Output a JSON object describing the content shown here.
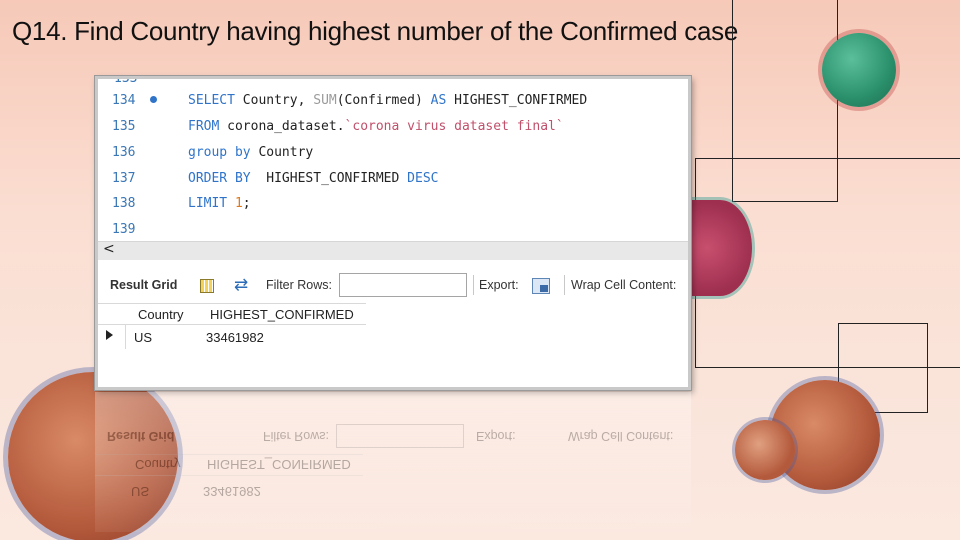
{
  "slide": {
    "title": "Q14. Find Country having highest number of the Confirmed case"
  },
  "editor": {
    "lines": [
      {
        "no": "134",
        "has_marker": true,
        "text": "SELECT Country, SUM(Confirmed) AS HIGHEST_CONFIRMED"
      },
      {
        "no": "135",
        "has_marker": false,
        "text": "FROM corona_dataset.`corona virus dataset final`"
      },
      {
        "no": "136",
        "has_marker": false,
        "text": "group by Country"
      },
      {
        "no": "137",
        "has_marker": false,
        "text": "ORDER BY  HIGHEST_CONFIRMED DESC"
      },
      {
        "no": "138",
        "has_marker": false,
        "text": "LIMIT 1;"
      },
      {
        "no": "139",
        "has_marker": false,
        "text": ""
      }
    ],
    "parts": {
      "l134": {
        "select": "SELECT",
        "a": " Country, ",
        "sum": "SUM",
        "b": "(Confirmed) ",
        "as": "AS",
        "c": " HIGHEST_CONFIRMED"
      },
      "l135": {
        "from": "FROM",
        "a": " corona_dataset.",
        "str": "`corona virus dataset final`"
      },
      "l136": {
        "group": "group by",
        "a": " Country"
      },
      "l137": {
        "order": "ORDER BY",
        "a": "  HIGHEST_CONFIRMED ",
        "desc": "DESC"
      },
      "l138": {
        "limit": "LIMIT",
        "a": " ",
        "num": "1",
        "b": ";"
      }
    },
    "scroll_left_glyph": "<"
  },
  "toolbar": {
    "result_grid_label": "Result Grid",
    "filter_rows_label": "Filter Rows:",
    "filter_rows_value": "",
    "export_label": "Export:",
    "wrap_cell_label": "Wrap Cell Content:"
  },
  "result": {
    "columns": [
      "Country",
      "HIGHEST_CONFIRMED"
    ],
    "rows": [
      [
        "US",
        "33461982"
      ]
    ]
  },
  "colors": {
    "keyword": "#2f74c9",
    "function": "#9b9b9b",
    "string": "#c0506b",
    "number": "#e07a1a",
    "line_number": "#3a77b6"
  },
  "icons": [
    "bullet-dot-icon",
    "grid-icon",
    "refresh-icon",
    "export-icon",
    "row-marker-icon",
    "virus-icon"
  ]
}
